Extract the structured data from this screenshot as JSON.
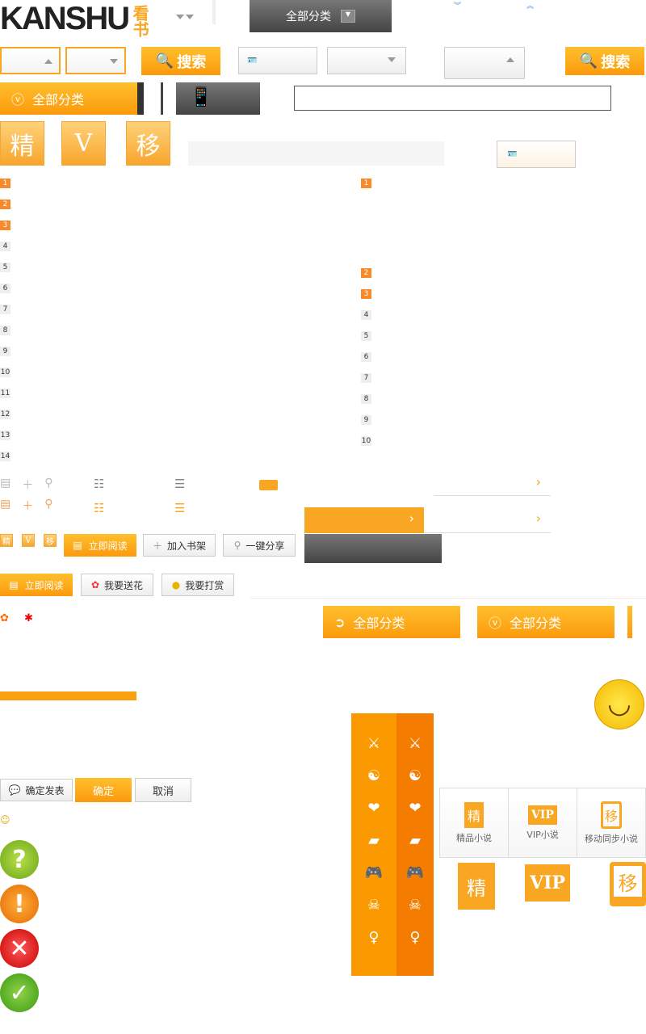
{
  "logo": {
    "text": "KANSHU",
    "cn": "看书"
  },
  "header": {
    "all_categories": "全部分类",
    "search": "搜索"
  },
  "badges": {
    "jing": "精",
    "vip": "V",
    "yi": "移"
  },
  "rank_left": [
    "1",
    "2",
    "3",
    "4",
    "5",
    "6",
    "7",
    "8",
    "9",
    "10",
    "11",
    "12",
    "13",
    "14"
  ],
  "rank_right": [
    "1",
    "2",
    "3",
    "4",
    "5",
    "6",
    "7",
    "8",
    "9",
    "10"
  ],
  "buttons": {
    "read_now": "立即阅读",
    "add_shelf": "加入书架",
    "share": "一键分享",
    "send_flower": "我要送花",
    "reward": "我要打赏",
    "confirm_post": "确定发表",
    "confirm": "确定",
    "cancel": "取消"
  },
  "features": [
    {
      "label": "精品小说",
      "glyph": "精"
    },
    {
      "label": "VIP小说",
      "glyph": "VIP"
    },
    {
      "label": "移动同步小说",
      "glyph": "移"
    }
  ],
  "colors": {
    "accent": "#fb9a0c",
    "accent_dark": "#f47c00"
  }
}
